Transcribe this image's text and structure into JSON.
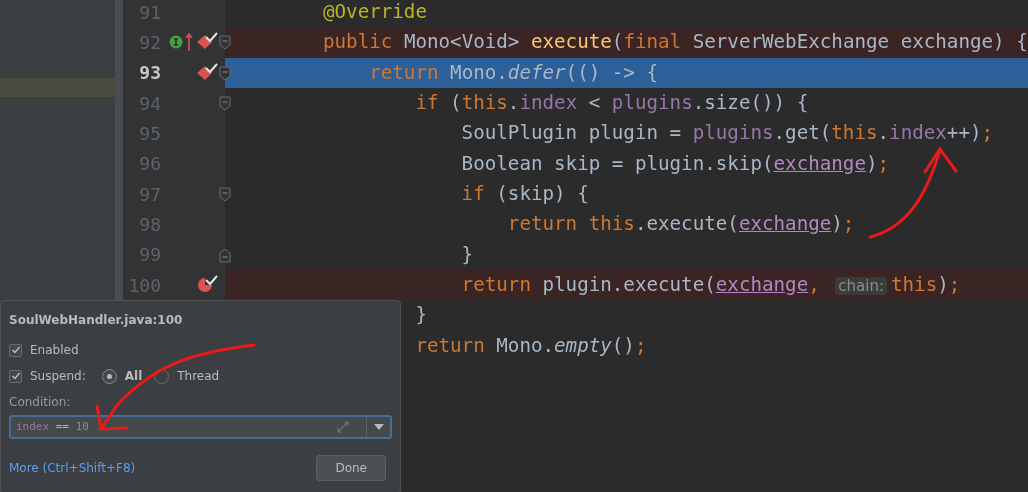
{
  "editor": {
    "lines": [
      {
        "number": "91",
        "current": false,
        "kind": "plain",
        "tokens": [
          {
            "text": "@Override",
            "kind": "annotation"
          }
        ]
      },
      {
        "number": "92",
        "current": false,
        "kind": "breakpoint",
        "icons": [
          {
            "kind": "implements"
          },
          {
            "kind": "override"
          },
          {
            "kind": "breakpoint"
          }
        ],
        "fold": {
          "kind": "start"
        },
        "tokens": [
          {
            "text": "public ",
            "kind": "keyword"
          },
          {
            "text": "Mono<Void> ",
            "kind": "plain"
          },
          {
            "text": "execute",
            "kind": "method"
          },
          {
            "text": "(",
            "kind": "plain"
          },
          {
            "text": "final ",
            "kind": "keyword"
          },
          {
            "text": "ServerWebExchange exchange) {",
            "kind": "plain"
          }
        ]
      },
      {
        "number": "93",
        "current": true,
        "kind": "execution",
        "icons": [
          {
            "kind": "breakpoint"
          }
        ],
        "fold": {
          "kind": "start"
        },
        "tokens": [
          {
            "text": "    return ",
            "kind": "keyword"
          },
          {
            "text": "Mono.",
            "kind": "plain"
          },
          {
            "text": "defer",
            "kind": "italic"
          },
          {
            "text": "(() -> {",
            "kind": "plain"
          }
        ]
      },
      {
        "number": "94",
        "current": false,
        "kind": "plain",
        "fold": {
          "kind": "start"
        },
        "tokens": [
          {
            "text": "        if ",
            "kind": "keyword"
          },
          {
            "text": "(",
            "kind": "plain"
          },
          {
            "text": "this",
            "kind": "keyword"
          },
          {
            "text": ".",
            "kind": "plain"
          },
          {
            "text": "index",
            "kind": "field"
          },
          {
            "text": " < ",
            "kind": "plain"
          },
          {
            "text": "plugins",
            "kind": "field"
          },
          {
            "text": ".size()) {",
            "kind": "plain"
          }
        ]
      },
      {
        "number": "95",
        "current": false,
        "kind": "plain",
        "tokens": [
          {
            "text": "            SoulPlugin plugin = ",
            "kind": "plain"
          },
          {
            "text": "plugins",
            "kind": "field"
          },
          {
            "text": ".get(",
            "kind": "plain"
          },
          {
            "text": "this",
            "kind": "keyword"
          },
          {
            "text": ".",
            "kind": "plain"
          },
          {
            "text": "index",
            "kind": "field"
          },
          {
            "text": "++)",
            "kind": "plain"
          },
          {
            "text": ";",
            "kind": "keyword"
          }
        ]
      },
      {
        "number": "96",
        "current": false,
        "kind": "plain",
        "tokens": [
          {
            "text": "            Boolean skip = plugin.skip(",
            "kind": "plain"
          },
          {
            "text": "exchange",
            "kind": "param"
          },
          {
            "text": ")",
            "kind": "plain"
          },
          {
            "text": ";",
            "kind": "keyword"
          }
        ]
      },
      {
        "number": "97",
        "current": false,
        "kind": "plain",
        "fold": {
          "kind": "start"
        },
        "tokens": [
          {
            "text": "            if ",
            "kind": "keyword"
          },
          {
            "text": "(skip) {",
            "kind": "plain"
          }
        ]
      },
      {
        "number": "98",
        "current": false,
        "kind": "plain",
        "tokens": [
          {
            "text": "                return this",
            "kind": "keyword"
          },
          {
            "text": ".execute(",
            "kind": "plain"
          },
          {
            "text": "exchange",
            "kind": "param"
          },
          {
            "text": ")",
            "kind": "plain"
          },
          {
            "text": ";",
            "kind": "keyword"
          }
        ]
      },
      {
        "number": "99",
        "current": false,
        "kind": "plain",
        "fold": {
          "kind": "end"
        },
        "tokens": [
          {
            "text": "            }",
            "kind": "plain"
          }
        ]
      },
      {
        "number": "100",
        "current": false,
        "kind": "breakpoint",
        "icons": [
          {
            "kind": "conditional"
          }
        ],
        "tokens": [
          {
            "text": "            return ",
            "kind": "keyword"
          },
          {
            "text": "plugin.execute(",
            "kind": "plain"
          },
          {
            "text": "exchange",
            "kind": "param"
          },
          {
            "text": ", ",
            "kind": "keyword"
          },
          {
            "text": "chain:",
            "kind": "hint"
          },
          {
            "text": "this",
            "kind": "keyword"
          },
          {
            "text": ")",
            "kind": "plain"
          },
          {
            "text": ";",
            "kind": "keyword"
          }
        ]
      },
      {
        "kind": "plain",
        "tokens": [
          {
            "text": "        }",
            "kind": "plain"
          }
        ]
      },
      {
        "kind": "plain",
        "tokens": [
          {
            "text": "        return ",
            "kind": "keyword"
          },
          {
            "text": "Mono.",
            "kind": "plain"
          },
          {
            "text": "empty",
            "kind": "italic"
          },
          {
            "text": "()",
            "kind": "plain"
          },
          {
            "text": ";",
            "kind": "keyword"
          }
        ]
      }
    ]
  },
  "breakpoint_popup": {
    "title": "SoulWebHandler.java:100",
    "enabled": {
      "label": "Enabled",
      "checked": true
    },
    "suspend": {
      "label": "Suspend:",
      "checked": true,
      "options": [
        {
          "label": "All",
          "selected": true
        },
        {
          "label": "Thread",
          "selected": false
        }
      ]
    },
    "condition": {
      "label": "Condition:",
      "tokens": [
        {
          "text": "index",
          "kind": "field"
        },
        {
          "text": " == ",
          "kind": "plain"
        },
        {
          "text": "10",
          "kind": "number"
        }
      ]
    },
    "more_link": "More (Ctrl+Shift+F8)",
    "done_button": "Done"
  }
}
